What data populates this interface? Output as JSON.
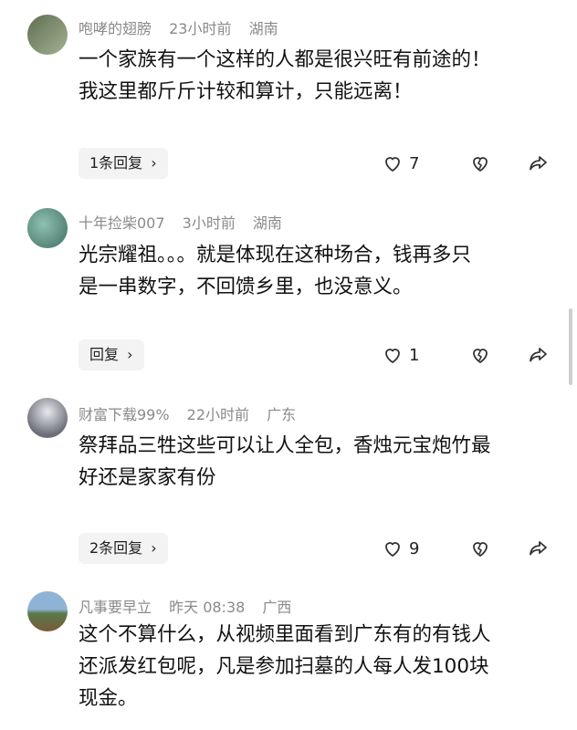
{
  "comments": [
    {
      "username": "咆哮的翅膀",
      "time": "23小时前",
      "location": "湖南",
      "lines": [
        "一个家族有一个这样的人都是很兴旺有前途的！",
        "我这里都斤斤计较和算计，只能远离！"
      ],
      "reply_label": "1条回复",
      "likes": "7",
      "avatar_colors": [
        "#6b7a5a",
        "#9aa88a"
      ]
    },
    {
      "username": "十年捡柴007",
      "time": "3小时前",
      "location": "湖南",
      "lines": [
        "光宗耀祖。。。就是体现在这种场合，钱再多只",
        "是一串数字，不回馈乡里，也没意义。"
      ],
      "reply_label": "回复",
      "likes": "1",
      "avatar_colors": [
        "#5e8a7a",
        "#7fb0a0"
      ]
    },
    {
      "username": "财富下载99%",
      "time": "22小时前",
      "location": "广东",
      "lines": [
        "祭拜品三牲这些可以让人全包，香烛元宝炮竹最",
        "好还是家家有份"
      ],
      "reply_label": "2条回复",
      "likes": "9",
      "avatar_colors": [
        "#6d6f78",
        "#c7c9cf"
      ]
    },
    {
      "username": "凡事要早立",
      "time": "昨天 08:38",
      "location": "广西",
      "lines": [
        "这个不算什么，从视频里面看到广东有的有钱人",
        "还派发红包呢，凡是参加扫墓的人每人发100块",
        "现金。"
      ],
      "avatar_colors": [
        "#6c8fb0",
        "#7a5a3a"
      ]
    }
  ],
  "icons": {
    "like": "heart-outline-icon",
    "dislike": "broken-heart-icon",
    "share": "share-arrow-icon",
    "chevron": "chevron-right-icon"
  }
}
